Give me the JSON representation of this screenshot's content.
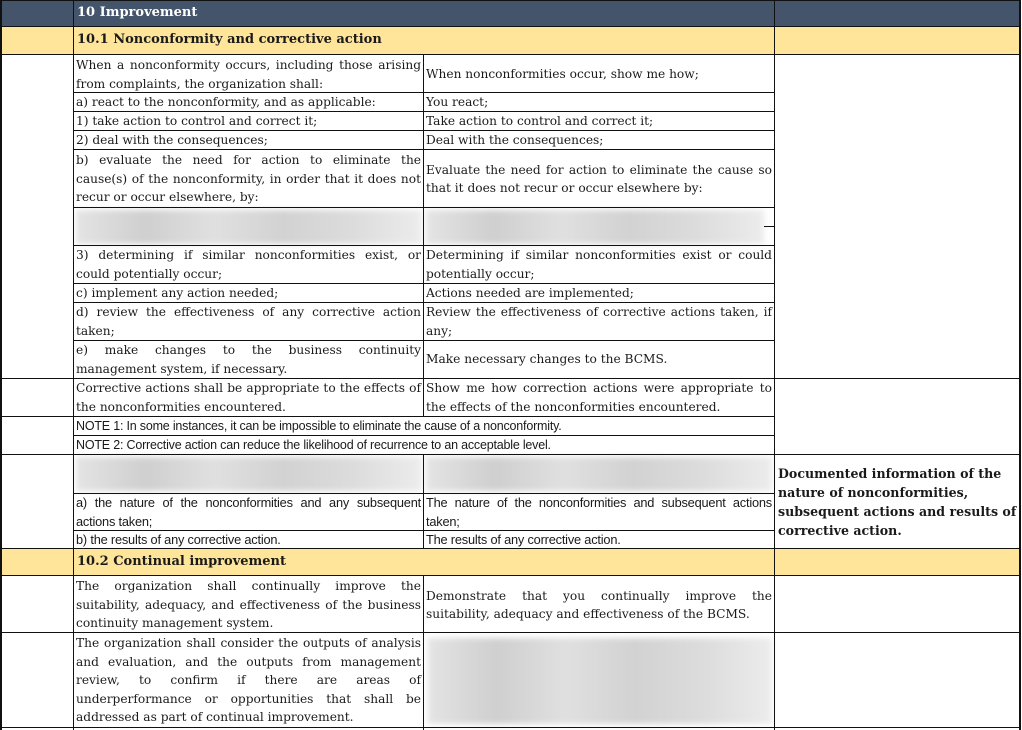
{
  "header": {
    "title": "10 Improvement",
    "color": "#44546a"
  },
  "sections": {
    "s101": {
      "title": "10.1 Nonconformity and corrective action",
      "color": "#ffe599"
    },
    "s102": {
      "title": "10.2 Continual improvement",
      "color": "#ffe599"
    }
  },
  "rows": {
    "r1": {
      "req": "When a nonconformity occurs, including those arising from complaints, the organization shall:",
      "audit": "When nonconformities occur, show me how;"
    },
    "r2": {
      "req": "a) react to the nonconformity, and as applicable:",
      "audit": "You react;"
    },
    "r3": {
      "req": "1) take action to control and correct it;",
      "audit": "Take action to control and correct it;"
    },
    "r4": {
      "req": "2) deal with the consequences;",
      "audit": "Deal with the consequences;"
    },
    "r5": {
      "req": "b) evaluate the need for action to eliminate the cause(s) of the nonconformity, in order that it does not recur or occur elsewhere, by:",
      "audit": "Evaluate the need for action to eliminate the cause so that it does not recur or occur elsewhere by:"
    },
    "r6": {
      "req": "",
      "audit": ""
    },
    "r7": {
      "req": "3) determining if similar nonconformities exist, or could potentially occur;",
      "audit": "Determining if similar nonconformities exist or could potentially occur;"
    },
    "r8": {
      "req": "c) implement any action needed;",
      "audit": "Actions needed are implemented;"
    },
    "r9": {
      "req": "d) review the effectiveness of any corrective action taken;",
      "audit": "Review the effectiveness of corrective actions taken, if any;"
    },
    "r10": {
      "req": "e) make changes to the business continuity management system, if necessary.",
      "audit": "Make necessary changes to the BCMS."
    },
    "r11": {
      "req": "Corrective actions shall be appropriate to the effects of the nonconformities encountered.",
      "audit": "Show me how correction actions were appropriate to the effects of the nonconformities encountered."
    },
    "note1": "NOTE 1: In some instances, it can be impossible to eliminate the cause of a nonconformity.",
    "note2": "NOTE 2: Corrective action can reduce the likelihood of recurrence to an acceptable level.",
    "r12": {
      "req": "",
      "audit": ""
    },
    "r13": {
      "req": "a) the nature of the nonconformities and any subsequent actions taken;",
      "audit": "The nature of the nonconformities and subsequent actions taken;"
    },
    "r14": {
      "req": "b) the results of any corrective action.",
      "audit": "The results of any corrective action."
    },
    "documented_info": "Documented information of the nature of nonconformities, subsequent actions and results of corrective action.",
    "r15": {
      "req": "The organization shall continually improve the suitability, adequacy, and effectiveness of the business continuity management system.",
      "audit": "Demonstrate that you continually improve the suitability, adequacy and effectiveness of the BCMS."
    },
    "r16": {
      "req": "The organization shall consider the outputs of analysis and evaluation, and the outputs from management review, to confirm if there are areas of underperformance or opportunities that shall be addressed as part of continual improvement.",
      "audit": ""
    }
  }
}
